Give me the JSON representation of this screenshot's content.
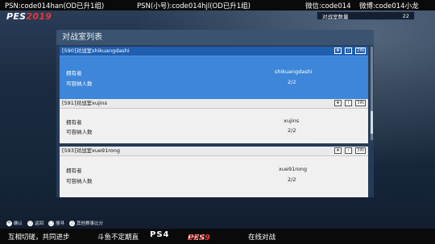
{
  "overlay": {
    "psn": "PSN:code014han(OD已升1组)",
    "psn_alt": "PSN(小号):code014hjl(OD已升1组)",
    "wechat": "微信:code014",
    "weibo": "微博:code014小龙",
    "footer_slogan": "互相切磋，共同进步",
    "footer_live": "斗鱼不定期直",
    "footer_ps4": "PS4",
    "footer_online": "在线对战"
  },
  "logo": {
    "pes": "PES",
    "year": "2019"
  },
  "room_count": {
    "label": "对战室数量",
    "value": "22"
  },
  "panel": {
    "title": "对战室列表"
  },
  "rooms": [
    {
      "header": "[590]对战室shikuangdashi",
      "owner_label": "拥有者",
      "owner": "shikuangdashi",
      "capacity_label": "可容纳人数",
      "capacity": "2/2",
      "badge": "2IN"
    },
    {
      "header": "[591]对战室xujins",
      "owner_label": "拥有者",
      "owner": "xujins",
      "capacity_label": "可容纳人数",
      "capacity": "2/2",
      "badge": "3IN"
    },
    {
      "header": "[593]对战室xue91rong",
      "owner_label": "拥有者",
      "owner": "xue91rong",
      "capacity_label": "可容纳人数",
      "capacity": "2/2",
      "badge": "3IN"
    }
  ],
  "controls": [
    {
      "icon": "cross-icon",
      "glyph": "✕",
      "label": "确认"
    },
    {
      "icon": "circle-icon",
      "glyph": "○",
      "label": "返回"
    },
    {
      "icon": "square-icon",
      "glyph": "□",
      "label": "搜寻"
    },
    {
      "icon": "triangle-icon",
      "glyph": "△",
      "label": "其他赛事比分"
    }
  ]
}
